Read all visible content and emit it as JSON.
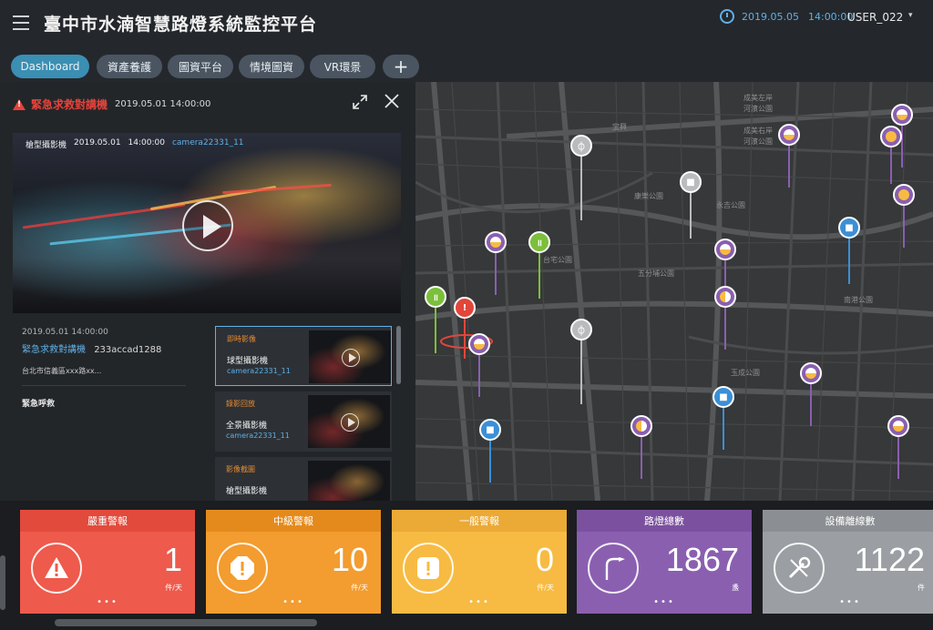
{
  "header": {
    "title": "臺中市水湳智慧路燈系統監控平台",
    "date": "2019.05.05",
    "time": "14:00:00",
    "user": "USER_022",
    "user_caret": "▾"
  },
  "tabs": [
    {
      "label": "Dashboard"
    },
    {
      "label": "資產養護"
    },
    {
      "label": "圖資平台"
    },
    {
      "label": "情境圖資"
    },
    {
      "label": "VR環景"
    },
    {
      "label": "+"
    }
  ],
  "alert_panel": {
    "title": "緊急求救對講機",
    "timestamp": "2019.05.01  14:00:00",
    "video": {
      "camera_type": "槍型攝影機",
      "date": "2019.05.01",
      "time": "14:00:00",
      "camera_id": "camera22331_11"
    },
    "detail": {
      "date": "2019.05.01  14:00:00",
      "name": "緊急求救對講機",
      "id": "233accad1288",
      "address": "台北市信義區xxx路xx...",
      "status": "緊急呼救"
    },
    "media": [
      {
        "label": "即時影像",
        "name": "球型攝影機",
        "camera": "camera22331_11"
      },
      {
        "label": "錄影回放",
        "name": "全景攝影機",
        "camera": "camera22331_11"
      },
      {
        "label": "影像截圖",
        "name": "槍型攝影機",
        "camera": ""
      }
    ]
  },
  "map_labels": [
    "成美左岸",
    "河濱公園",
    "成美右岸",
    "河濱公園",
    "台宅公園",
    "五分埔公園",
    "玉成公園",
    "南港公園",
    "永吉公園",
    "康樂公園",
    "宝興"
  ],
  "stats": [
    {
      "label": "嚴重警報",
      "value": "1",
      "unit": "件/天",
      "more": "•••",
      "color": "#ee5a4c",
      "head_color": "#e24a3c",
      "icon": "warning-triangle-icon"
    },
    {
      "label": "中級警報",
      "value": "10",
      "unit": "件/天",
      "more": "•••",
      "color": "#f39c2f",
      "head_color": "#e48a1c",
      "icon": "warning-octagon-icon"
    },
    {
      "label": "一般警報",
      "value": "0",
      "unit": "件/天",
      "more": "•••",
      "color": "#f7bb43",
      "head_color": "#eba935",
      "icon": "warning-square-icon"
    },
    {
      "label": "路燈總數",
      "value": "1867",
      "unit": "盞",
      "more": "•••",
      "color": "#8a5fb0",
      "head_color": "#7b519f",
      "icon": "streetlight-icon"
    },
    {
      "label": "設備離線數",
      "value": "1122",
      "unit": "件",
      "more": "•••",
      "color": "#9b9ea2",
      "head_color": "#8b8e92",
      "icon": "wrench-icon"
    }
  ],
  "pin_colors": {
    "purple": "#8a5fb0",
    "yellow": "#f7bb43",
    "blue": "#3a8fd6",
    "green": "#7bbf3a",
    "red": "#e2463a",
    "grey": "#b9bcbf"
  }
}
